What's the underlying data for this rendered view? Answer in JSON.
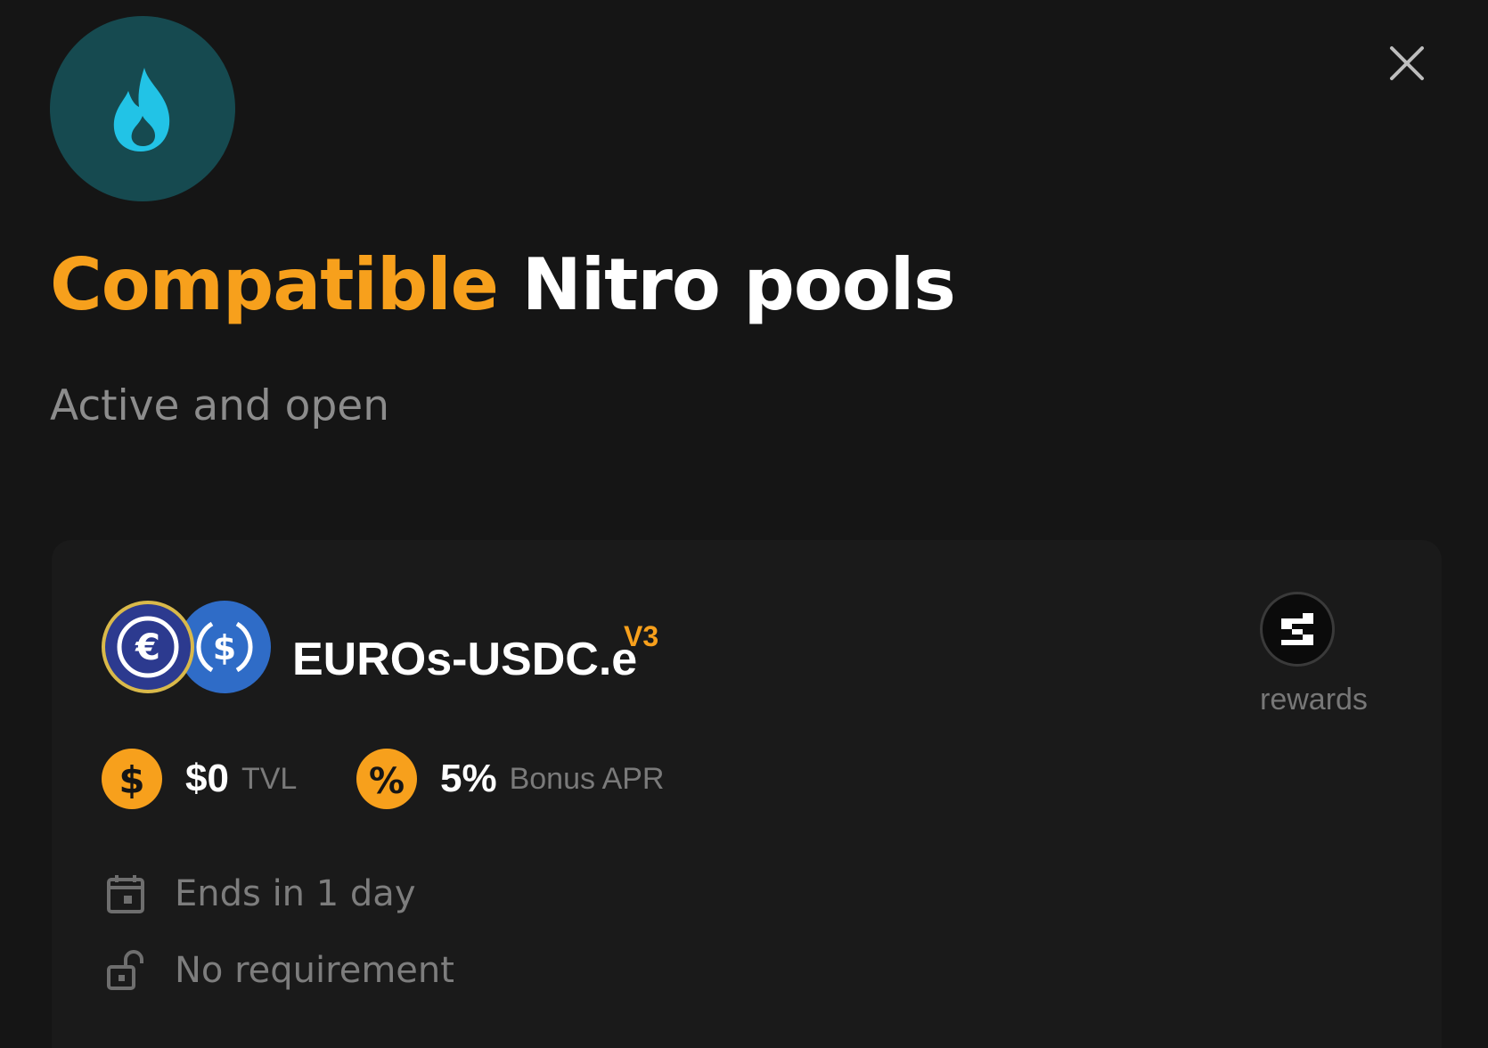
{
  "modal": {
    "title_accent": "Compatible",
    "title_main": "Nitro pools",
    "subtitle": "Active and open",
    "header_icon": "flame-icon",
    "close_icon": "close-icon"
  },
  "pool": {
    "pair_name": "EUROs-USDC.e",
    "version": "V3",
    "token_icons": [
      "euros-token-icon",
      "usdc-token-icon"
    ],
    "reward_icon": "reward-token-icon",
    "reward_label": "rewards",
    "tvl_value": "$0",
    "tvl_label": "TVL",
    "apr_value": "5%",
    "apr_label": "Bonus APR",
    "ends_text": "Ends in 1 day",
    "requirement_text": "No requirement"
  },
  "colors": {
    "accent": "#f7a01c",
    "background": "#151515",
    "card": "#1a1a1a",
    "header_circle": "#164a50",
    "flame": "#22c3e6"
  }
}
